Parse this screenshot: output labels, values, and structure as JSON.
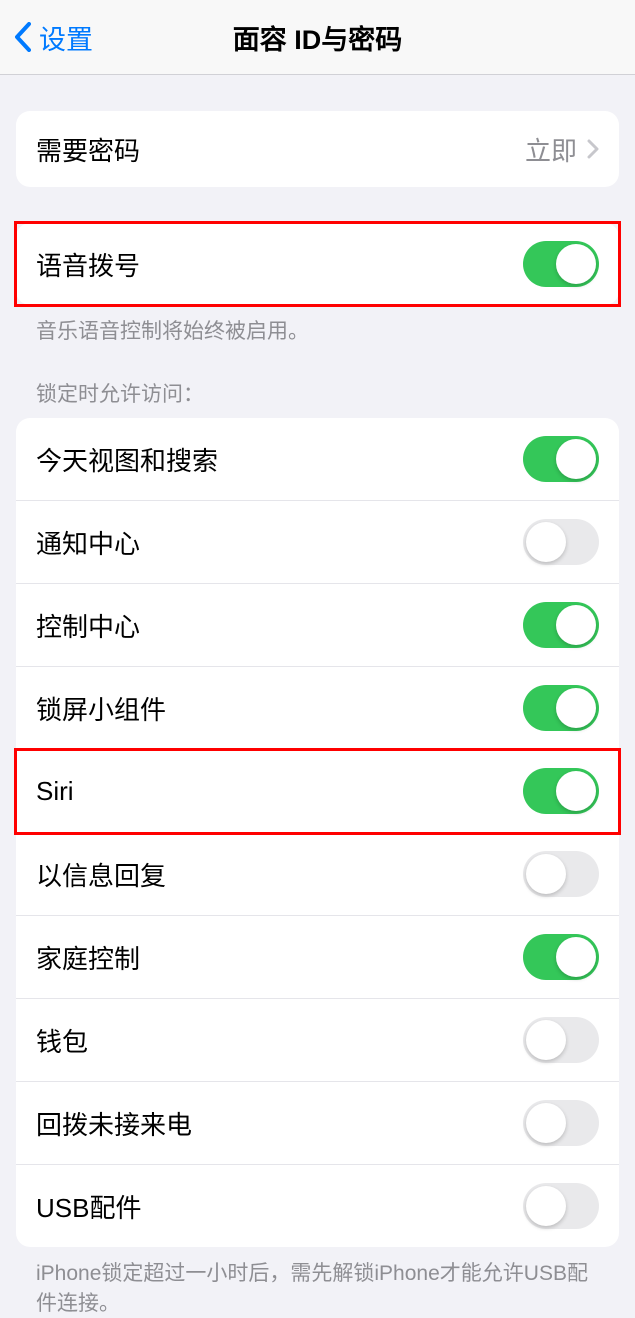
{
  "nav": {
    "back_label": "设置",
    "title": "面容 ID与密码"
  },
  "passcode_group": {
    "require_passcode": {
      "label": "需要密码",
      "value": "立即"
    }
  },
  "voice_dial_group": {
    "voice_dial": {
      "label": "语音拨号",
      "enabled": true
    },
    "footer": "音乐语音控制将始终被启用。"
  },
  "lock_access": {
    "header": "锁定时允许访问：",
    "items": [
      {
        "label": "今天视图和搜索",
        "enabled": true
      },
      {
        "label": "通知中心",
        "enabled": false
      },
      {
        "label": "控制中心",
        "enabled": true
      },
      {
        "label": "锁屏小组件",
        "enabled": true
      },
      {
        "label": "Siri",
        "enabled": true
      },
      {
        "label": "以信息回复",
        "enabled": false
      },
      {
        "label": "家庭控制",
        "enabled": true
      },
      {
        "label": "钱包",
        "enabled": false
      },
      {
        "label": "回拨未接来电",
        "enabled": false
      },
      {
        "label": "USB配件",
        "enabled": false
      }
    ],
    "footer": "iPhone锁定超过一小时后，需先解锁iPhone才能允许USB配件连接。"
  }
}
